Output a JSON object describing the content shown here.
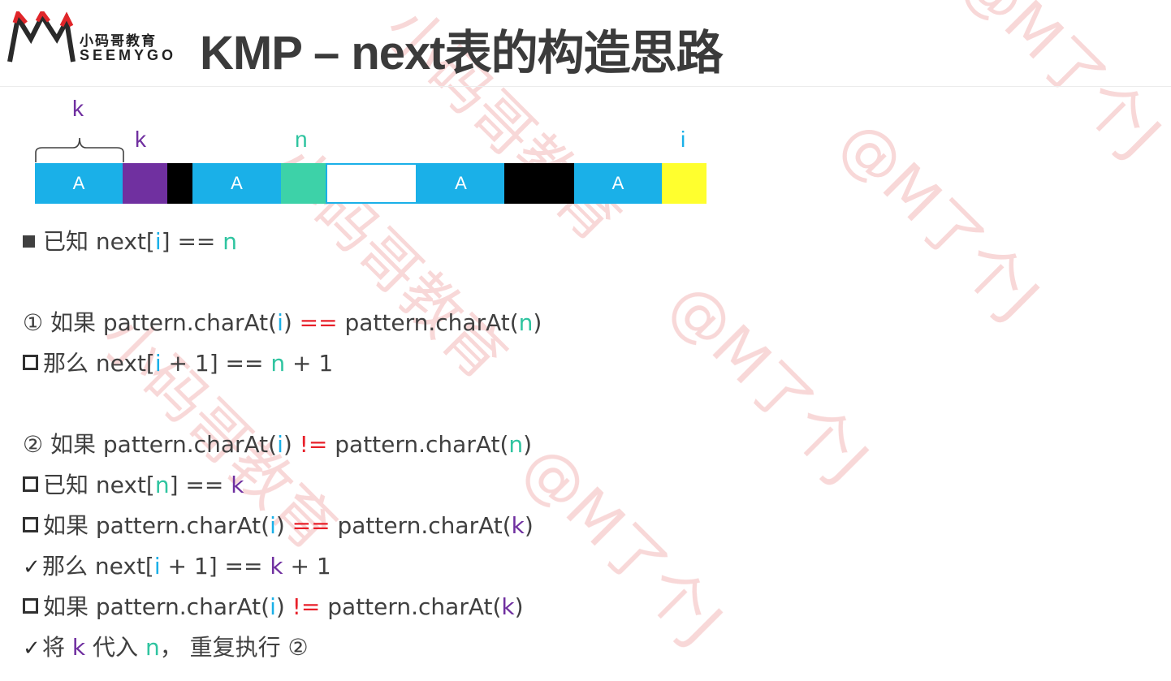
{
  "header": {
    "logo_cn": "小码哥教育",
    "logo_en": "SEEMYGO",
    "title": "KMP – next表的构造思路"
  },
  "watermark": {
    "texts": [
      "小码哥教育",
      "@M了个J"
    ],
    "color": "#f3b9b9"
  },
  "diagram": {
    "brace_label": "k",
    "label_k": "k",
    "label_n": "n",
    "label_i": "i",
    "segments": [
      {
        "name": "segment-a-1",
        "text": "A",
        "color": "#1ab0e8"
      },
      {
        "name": "segment-k",
        "text": "",
        "color": "#7030a0"
      },
      {
        "name": "segment-black-1",
        "text": "",
        "color": "#000000"
      },
      {
        "name": "segment-a-2",
        "text": "A",
        "color": "#1ab0e8"
      },
      {
        "name": "segment-n",
        "text": "",
        "color": "#3dd2a8"
      },
      {
        "name": "segment-white",
        "text": "",
        "color": "#ffffff"
      },
      {
        "name": "segment-a-3",
        "text": "A",
        "color": "#1ab0e8"
      },
      {
        "name": "segment-black-2",
        "text": "",
        "color": "#000000"
      },
      {
        "name": "segment-a-4",
        "text": "A",
        "color": "#1ab0e8"
      },
      {
        "name": "segment-i",
        "text": "",
        "color": "#ffff2e"
      }
    ]
  },
  "lines": {
    "l1": {
      "a": "已知 next[",
      "i": "i",
      "b": "] == ",
      "n": "n"
    },
    "l2": {
      "a": "① 如果 pattern.charAt(",
      "i": "i",
      "b": ") ",
      "op": "==",
      "c": " pattern.charAt(",
      "n": "n",
      "d": ")"
    },
    "l3": {
      "a": "那么 next[",
      "i": "i",
      "b": " + 1] == ",
      "n": "n",
      "c": " + 1"
    },
    "l4": {
      "a": "② 如果 pattern.charAt(",
      "i": "i",
      "b": ") ",
      "op": "!=",
      "c": " pattern.charAt(",
      "n": "n",
      "d": ")"
    },
    "l5": {
      "a": "已知 next[",
      "n": "n",
      "b": "] == ",
      "k": "k"
    },
    "l6": {
      "a": "如果 pattern.charAt(",
      "i": "i",
      "b": ") ",
      "op": "==",
      "c": " pattern.charAt(",
      "k": "k",
      "d": ")"
    },
    "l7": {
      "check": "✓",
      "a": "那么 next[",
      "i": "i",
      "b": " + 1] == ",
      "k": "k",
      "c": " + 1"
    },
    "l8": {
      "a": "如果 pattern.charAt(",
      "i": "i",
      "b": ") ",
      "op": "!=",
      "c": " pattern.charAt(",
      "k": "k",
      "d": ")"
    },
    "l9": {
      "check": "✓",
      "a": "将 ",
      "k": "k",
      "b": " 代入 ",
      "n": "n",
      "c": "， 重复执行 ②"
    }
  }
}
